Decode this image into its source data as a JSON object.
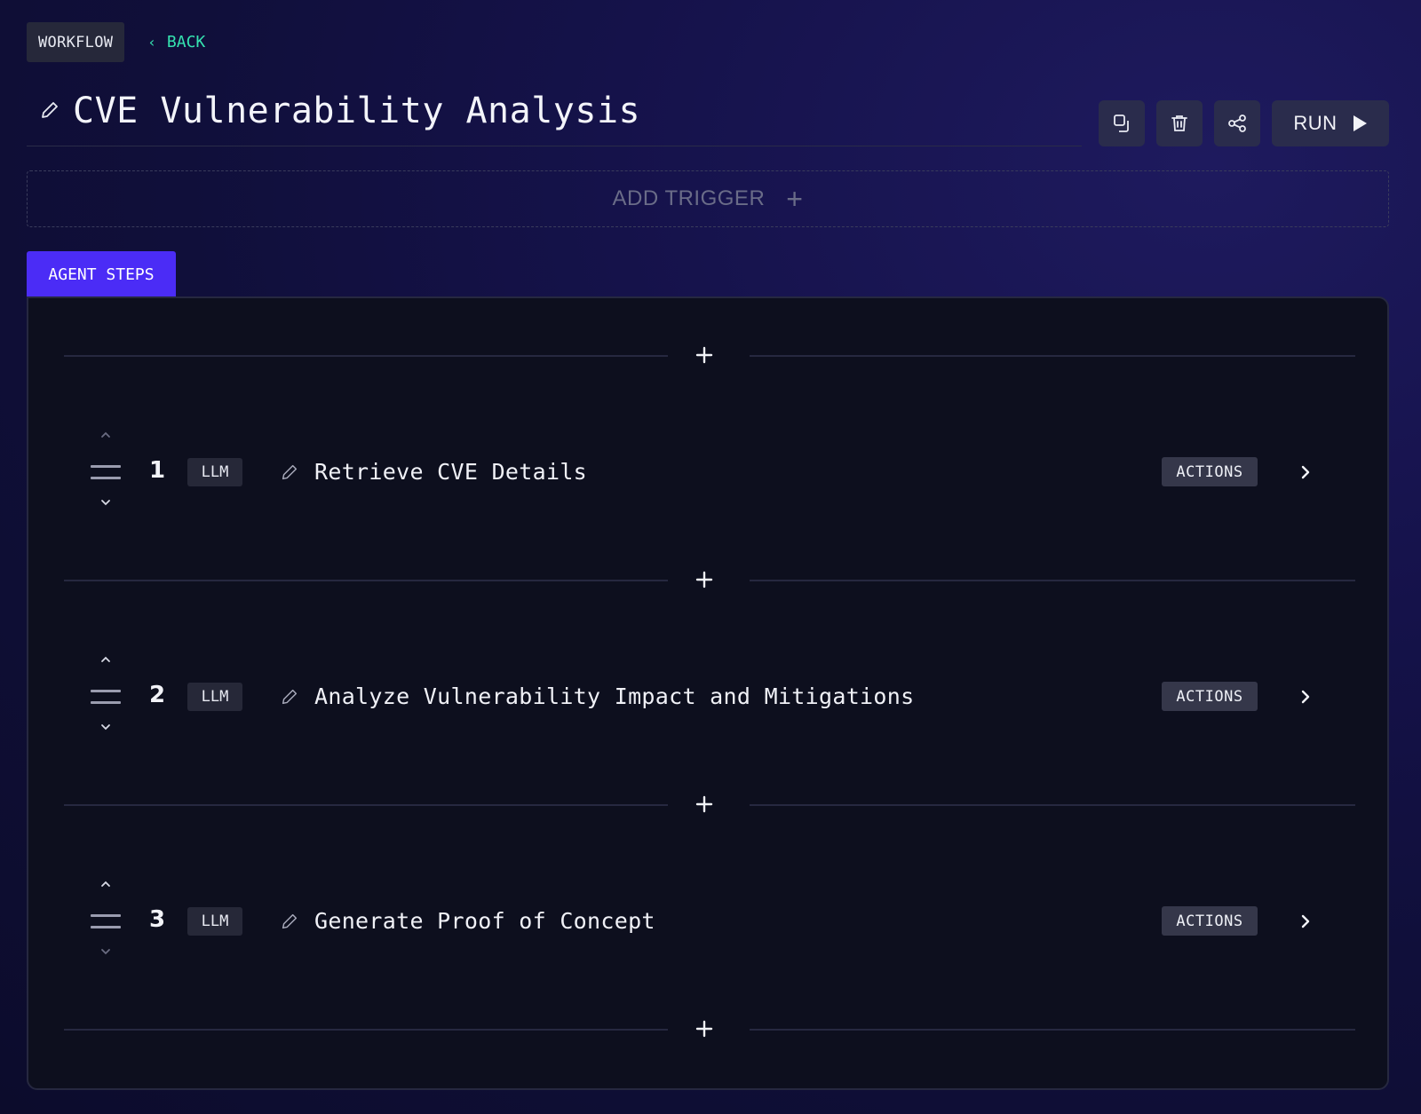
{
  "header": {
    "workflow_label": "WORKFLOW",
    "back_label": "BACK",
    "title": "CVE Vulnerability Analysis"
  },
  "toolbar": {
    "duplicate_icon": "copy-icon",
    "delete_icon": "trash-icon",
    "share_icon": "share-icon",
    "run_label": "RUN",
    "run_icon": "play-icon"
  },
  "trigger": {
    "label": "ADD TRIGGER",
    "icon": "plus-icon"
  },
  "tabs": {
    "agent_steps": "AGENT STEPS"
  },
  "steps": [
    {
      "number": "1",
      "type": "LLM",
      "title": "Retrieve CVE Details",
      "actions_label": "ACTIONS"
    },
    {
      "number": "2",
      "type": "LLM",
      "title": "Analyze Vulnerability Impact and Mitigations",
      "actions_label": "ACTIONS"
    },
    {
      "number": "3",
      "type": "LLM",
      "title": "Generate Proof of Concept",
      "actions_label": "ACTIONS"
    }
  ],
  "colors": {
    "accent_tab": "#4b2cf6",
    "back_link": "#35e3b0",
    "panel_bg": "#0d0f1e",
    "button_bg": "#2a2c4c"
  }
}
